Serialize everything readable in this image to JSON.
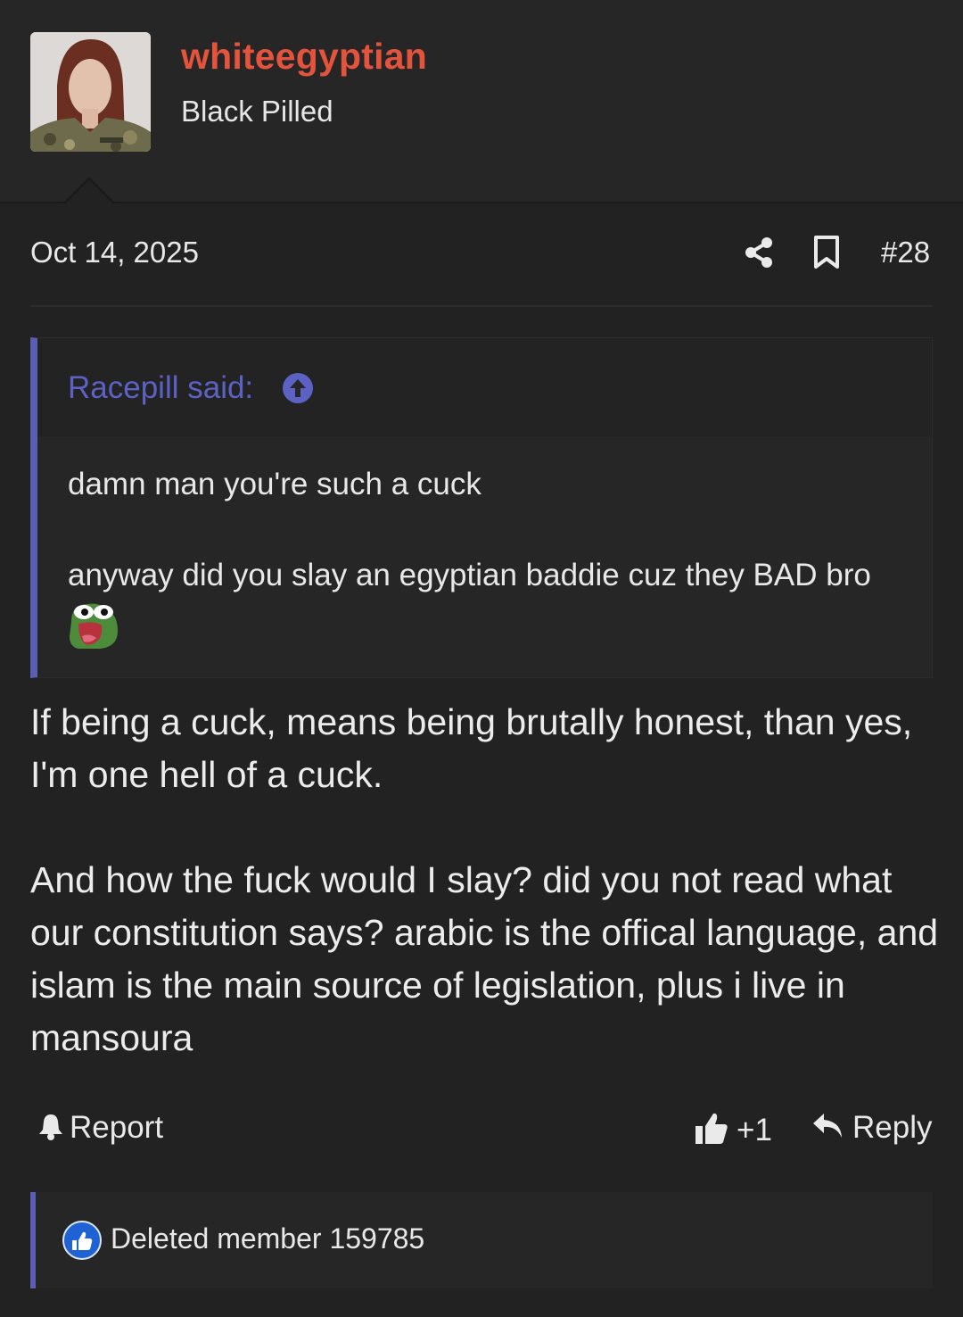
{
  "author": {
    "username": "whiteegyptian",
    "user_title": "Black Pilled",
    "username_color": "#e4533b"
  },
  "post": {
    "date": "Oct 14, 2025",
    "number": "#28",
    "share_icon": "share-icon",
    "bookmark_icon": "bookmark-icon"
  },
  "quote": {
    "author_label": "Racepill said:",
    "line1": "damn man you're such a cuck",
    "line2": "anyway did you slay an egyptian baddie cuz they BAD bro",
    "emoji": "pog-frog-emoji",
    "accent_color": "#5b5fb4"
  },
  "body": {
    "paragraph1": "If being a cuck, means being brutally honest, than yes, I'm one hell of a cuck.",
    "paragraph2": "And how the fuck would I slay? did you not read what our constitution says? arabic is the offical language, and islam is the main source of legislation, plus i live in mansoura"
  },
  "actions": {
    "report_label": "Report",
    "like_count": "+1",
    "reply_label": "Reply"
  },
  "reactions": {
    "member": "Deleted member 159785",
    "icon": "like-reaction-icon"
  }
}
